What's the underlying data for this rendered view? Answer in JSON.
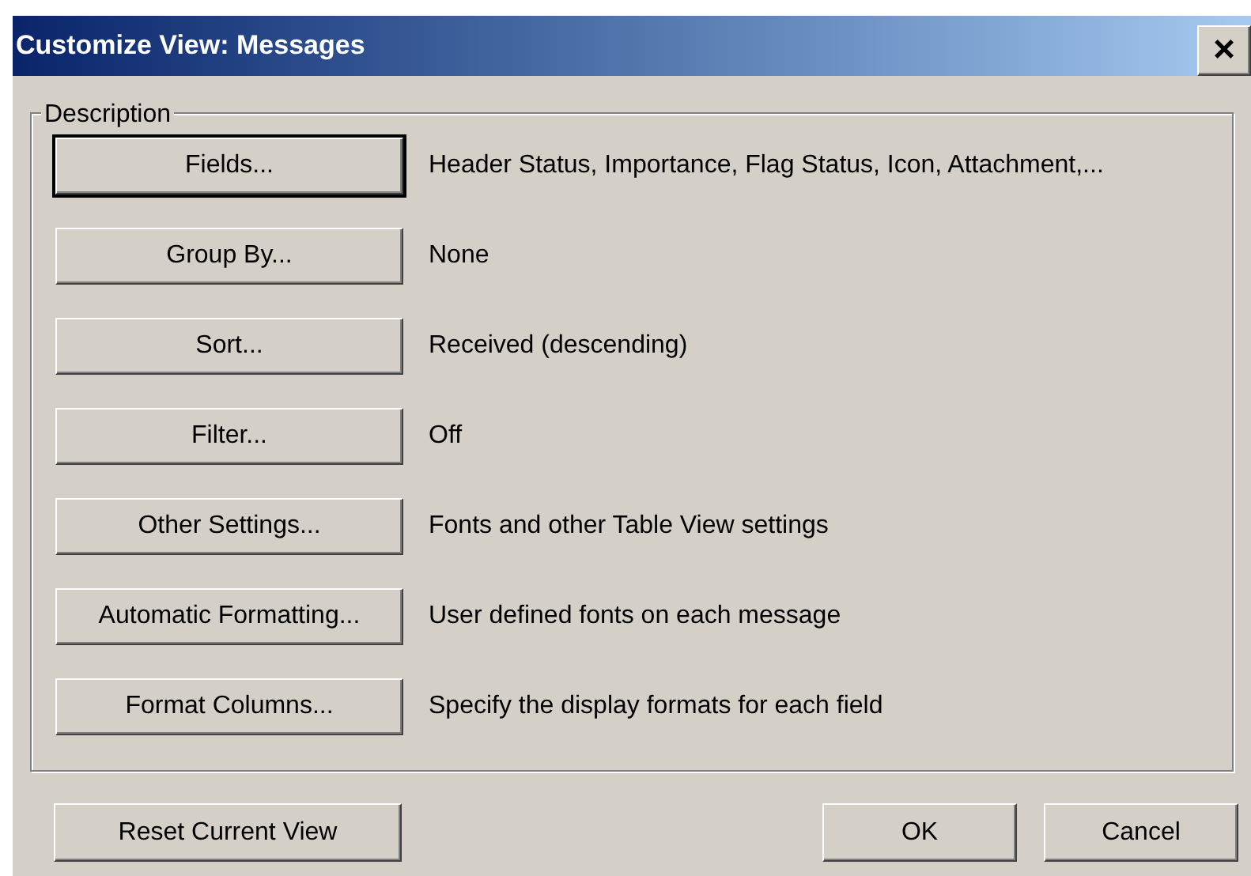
{
  "window": {
    "title": "Customize View: Messages",
    "close": "×"
  },
  "group": {
    "label": "Description"
  },
  "rows": [
    {
      "button": "Fields...",
      "description": "Header Status, Importance, Flag Status, Icon, Attachment,...",
      "default": true
    },
    {
      "button": "Group By...",
      "description": "None",
      "default": false
    },
    {
      "button": "Sort...",
      "description": "Received (descending)",
      "default": false
    },
    {
      "button": "Filter...",
      "description": "Off",
      "default": false
    },
    {
      "button": "Other Settings...",
      "description": "Fonts and other Table View settings",
      "default": false
    },
    {
      "button": "Automatic Formatting...",
      "description": "User defined fonts on each message",
      "default": false
    },
    {
      "button": "Format Columns...",
      "description": "Specify the display formats for each field",
      "default": false
    }
  ],
  "footer": {
    "reset": "Reset Current View",
    "ok": "OK",
    "cancel": "Cancel"
  }
}
